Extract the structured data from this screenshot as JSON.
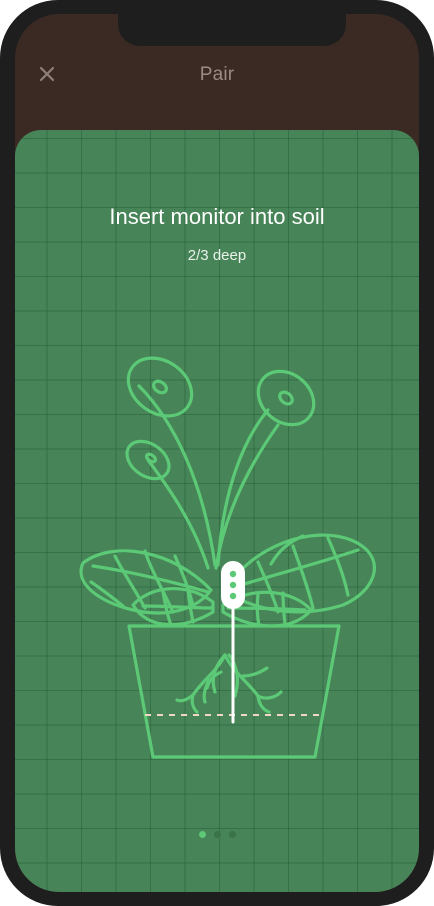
{
  "header": {
    "title": "Pair",
    "close_icon": "close-icon"
  },
  "content": {
    "heading": "Insert monitor into soil",
    "subheading": "2/3 deep",
    "illustration_icon": "plant-with-monitor-icon"
  },
  "pagination": {
    "total": 3,
    "active_index": 0
  },
  "colors": {
    "header_bg": "#3b2a24",
    "card_bg": "#478457",
    "line_green": "#5cc977",
    "title_text": "#9a8b84"
  }
}
